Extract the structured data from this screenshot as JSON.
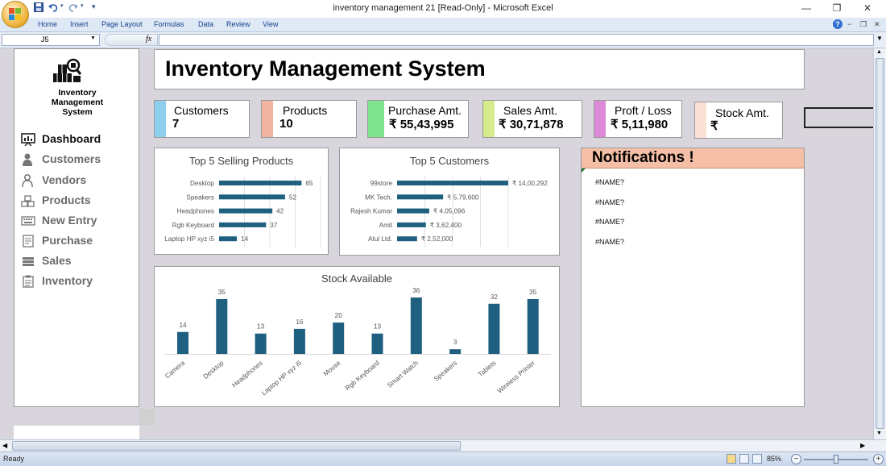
{
  "window": {
    "title": "inventory management 21  [Read-Only]  -  Microsoft Excel",
    "minimize": "—",
    "restore": "❐",
    "close": "✕"
  },
  "quick_access": {
    "save_icon": "save-icon",
    "undo_icon": "undo-icon",
    "redo_icon": "redo-icon",
    "customize": "▾"
  },
  "ribbon_tabs": [
    "Home",
    "Insert",
    "Page Layout",
    "Formulas",
    "Data",
    "Review",
    "View"
  ],
  "formula_bar": {
    "name_box": "J5",
    "fx": "fx",
    "formula": ""
  },
  "sidebar": {
    "logo_text": "Inventory\nManagement\nSystem",
    "items": [
      {
        "label": "Dashboard",
        "icon": "presentation-board-icon",
        "active": true
      },
      {
        "label": "Customers",
        "icon": "person-icon",
        "active": false
      },
      {
        "label": "Vendors",
        "icon": "user-outline-icon",
        "active": false
      },
      {
        "label": "Products",
        "icon": "boxes-icon",
        "active": false
      },
      {
        "label": "New Entry",
        "icon": "keyboard-icon",
        "active": false
      },
      {
        "label": "Purchase",
        "icon": "receipt-icon",
        "active": false
      },
      {
        "label": "Sales",
        "icon": "coins-icon",
        "active": false
      },
      {
        "label": "Inventory",
        "icon": "clipboard-icon",
        "active": false
      }
    ]
  },
  "main_title": "Inventory Management System",
  "cards": [
    {
      "label": "Customers",
      "value": "7",
      "color": "#8ecfee"
    },
    {
      "label": "Products",
      "value": "10",
      "color": "#f0b4a0"
    },
    {
      "label": "Purchase Amt.",
      "value": "₹ 55,43,995",
      "color": "#7ee58e"
    },
    {
      "label": "Sales Amt.",
      "value": "₹ 30,71,878",
      "color": "#d6ec8c"
    },
    {
      "label": "Proft / Loss",
      "value": "₹ 5,11,980",
      "color": "#dc8ad8"
    },
    {
      "label": "Stock Amt.",
      "value": "₹",
      "color": "#fbe1d6"
    }
  ],
  "notifications": {
    "title": "Notifications !",
    "items": [
      "#NAME?",
      "#NAME?",
      "#NAME?",
      "#NAME?"
    ]
  },
  "chart_data": [
    {
      "type": "bar",
      "orientation": "horizontal",
      "title": "Top 5 Selling Products",
      "categories": [
        "Desktop",
        "Speakers",
        "Headphones",
        "Rgb Keyboard",
        "Laptop  HP xyz i5"
      ],
      "values": [
        65,
        52,
        42,
        37,
        14
      ],
      "labels": [
        "65",
        "52",
        "42",
        "37",
        "14"
      ],
      "color": "#1f5f7f",
      "xlim": [
        0,
        80
      ],
      "grid": true
    },
    {
      "type": "bar",
      "orientation": "horizontal",
      "title": "Top 5 Customers",
      "categories": [
        "99store",
        "MK Tech.",
        "Rajesh Kumar",
        "Amit",
        "Atul Ltd."
      ],
      "values": [
        1400292,
        579600,
        405096,
        362400,
        252000
      ],
      "labels": [
        "₹ 14,00,292",
        "₹ 5,79,600",
        "₹ 4,05,096",
        "₹ 3,62,400",
        "₹ 2,52,000"
      ],
      "color": "#1f5f7f",
      "xlim": [
        0,
        1400292
      ],
      "grid": true
    },
    {
      "type": "bar",
      "orientation": "vertical",
      "title": "Stock Available",
      "categories": [
        "Camera",
        "Desktop",
        "Headphones",
        "Laptop  HP xyz i5",
        "Mouse",
        "Rgb Keyboard",
        "Smart Watch",
        "Speakers",
        "Tablets",
        "Wireless Printer"
      ],
      "values": [
        14,
        35,
        13,
        16,
        20,
        13,
        36,
        3,
        32,
        35
      ],
      "labels": [
        "14",
        "35",
        "13",
        "16",
        "20",
        "13",
        "36",
        "3",
        "32",
        "35"
      ],
      "color": "#1f5f7f",
      "ylim": [
        0,
        36
      ],
      "grid": false
    }
  ],
  "status": {
    "text": "Ready",
    "zoom": "85%",
    "zoom_out": "−",
    "zoom_in": "+"
  }
}
